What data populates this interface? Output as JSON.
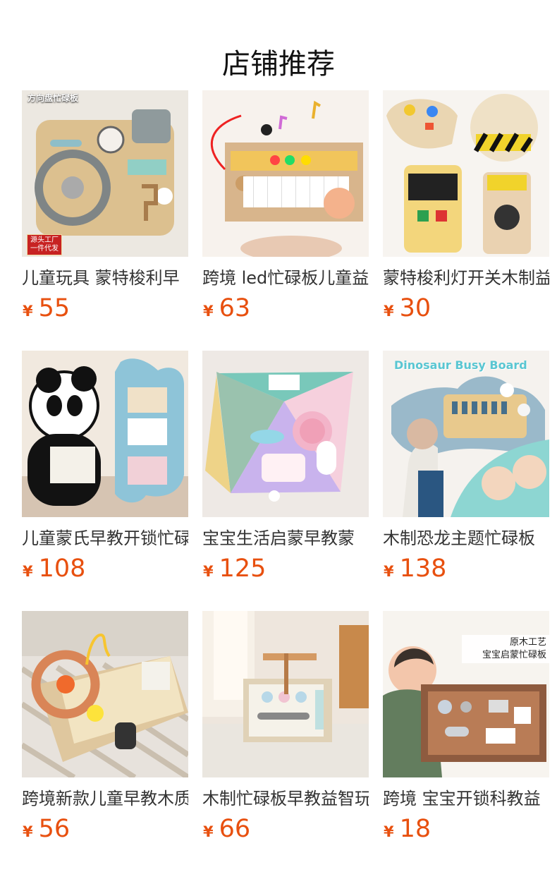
{
  "page": {
    "title": "店铺推荐"
  },
  "products": [
    {
      "name": "儿童玩具 蒙特梭利早",
      "currency": "¥",
      "price": "55",
      "image_overlay": "方向盘忙碌板",
      "image_badge_line1": "源头工厂",
      "image_badge_line2": "一件代发"
    },
    {
      "name": "跨境 led忙碌板儿童益",
      "currency": "¥",
      "price": "63"
    },
    {
      "name": "蒙特梭利灯开关木制益",
      "currency": "¥",
      "price": "30"
    },
    {
      "name": "儿童蒙氏早教开锁忙碌",
      "currency": "¥",
      "price": "108"
    },
    {
      "name": "宝宝生活启蒙早教蒙",
      "currency": "¥",
      "price": "125"
    },
    {
      "name": "木制恐龙主题忙碌板",
      "currency": "¥",
      "price": "138",
      "image_overlay": "Dinosaur Busy Board"
    },
    {
      "name": "跨境新款儿童早教木质",
      "currency": "¥",
      "price": "56"
    },
    {
      "name": "木制忙碌板早教益智玩",
      "currency": "¥",
      "price": "66"
    },
    {
      "name": "跨境 宝宝开锁科教益",
      "currency": "¥",
      "price": "18",
      "image_overlay_line1": "原木工艺",
      "image_overlay_line2": "宝宝启蒙忙碌板"
    }
  ]
}
